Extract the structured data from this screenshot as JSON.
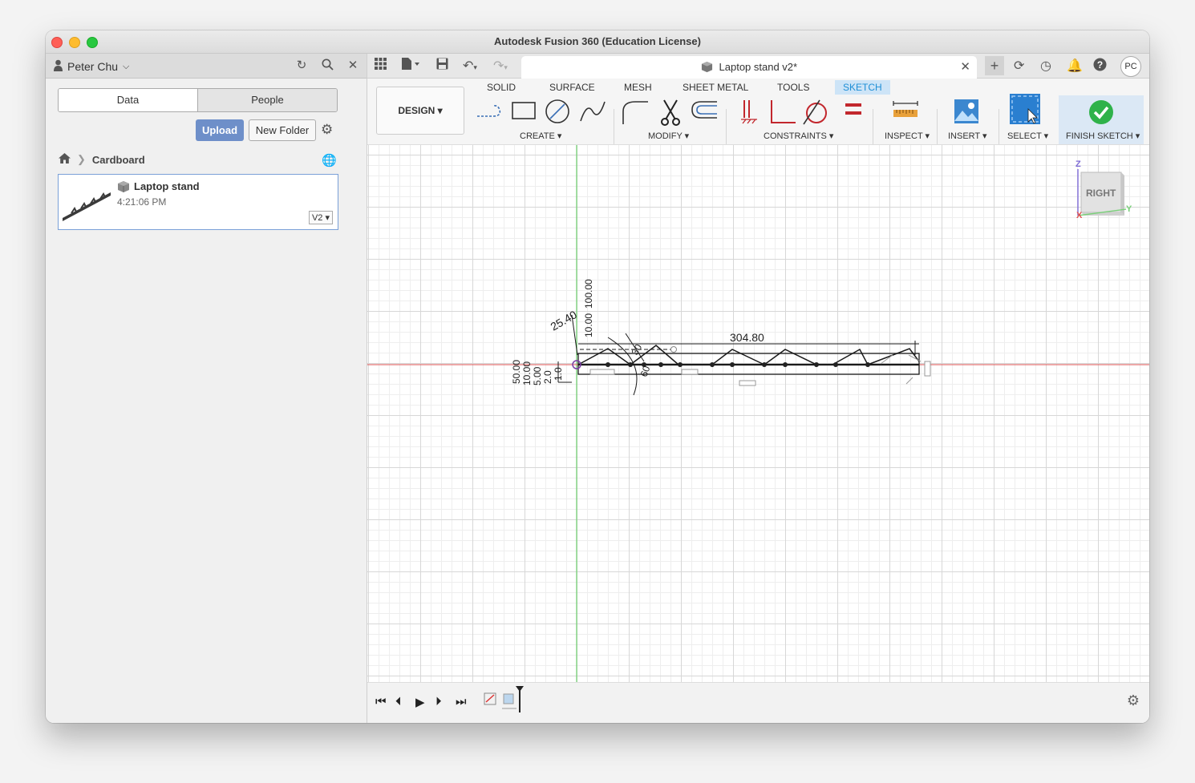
{
  "window": {
    "title": "Autodesk Fusion 360 (Education License)"
  },
  "data_panel": {
    "user_name": "Peter Chu",
    "tabs": [
      "Data",
      "People"
    ],
    "upload_label": "Upload",
    "new_folder_label": "New Folder",
    "breadcrumb_folder": "Cardboard",
    "file": {
      "name": "Laptop stand",
      "time": "4:21:06 PM",
      "version": "V2"
    }
  },
  "document": {
    "tab_title": "Laptop stand v2*",
    "avatar": "PC"
  },
  "ribbon": {
    "workspace": "DESIGN",
    "tabs": [
      "SOLID",
      "SURFACE",
      "MESH",
      "SHEET METAL",
      "TOOLS",
      "SKETCH"
    ],
    "active_tab": "SKETCH",
    "groups": {
      "create": "CREATE",
      "modify": "MODIFY",
      "constraints": "CONSTRAINTS",
      "inspect": "INSPECT",
      "insert": "INSERT",
      "select": "SELECT",
      "finish": "FINISH SKETCH"
    }
  },
  "viewcube": {
    "face": "RIGHT",
    "axis_z": "Z",
    "axis_x": "X",
    "axis_y": "Y"
  },
  "sketch_dims": {
    "length": "304.80",
    "angle_top": "25.40",
    "stack_vertical": "10.00",
    "stack_top": "100.00",
    "left_values": [
      "50.00",
      "10.00",
      "5.00",
      "2.0",
      "1.0"
    ],
    "angle_a": "30",
    "angle_b": "60"
  },
  "colors": {
    "accent": "#1f8fd6",
    "upload": "#6e8fc9",
    "finish_check": "#2fb24a"
  }
}
